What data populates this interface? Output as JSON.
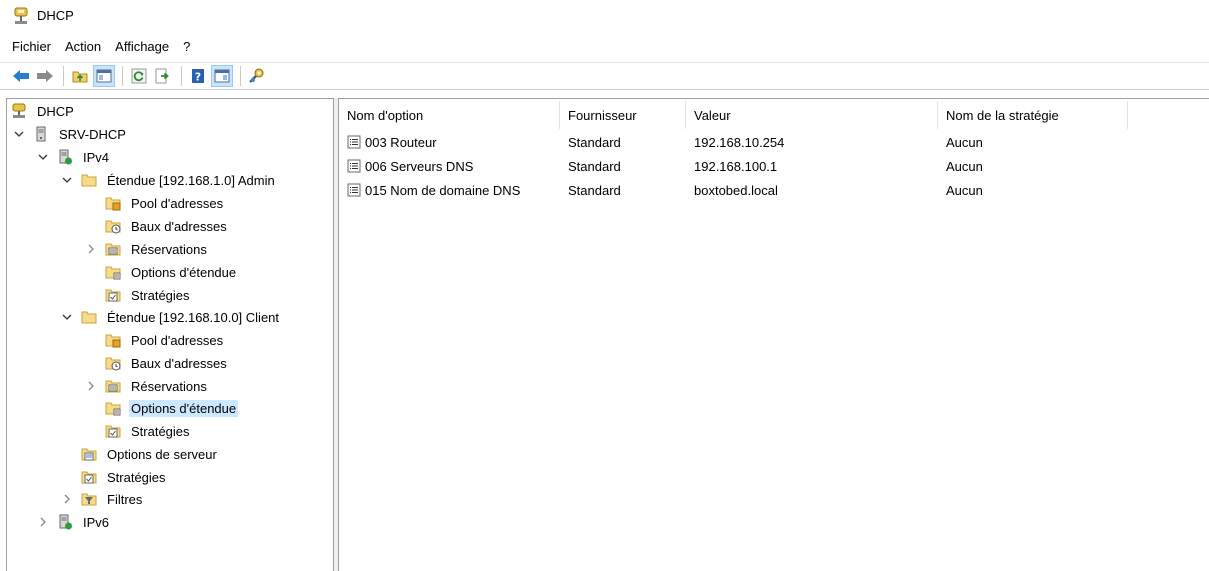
{
  "window": {
    "title": "DHCP"
  },
  "menu": [
    "Fichier",
    "Action",
    "Affichage",
    "?"
  ],
  "toolbar": {
    "buttons": [
      "back-icon",
      "forward-icon",
      "up-folder-icon",
      "show-tree-icon",
      "refresh-icon",
      "export-list-icon",
      "help-icon",
      "action-pane-icon",
      "manage-icon"
    ]
  },
  "tree": {
    "root": "DHCP",
    "server": "SRV-DHCP",
    "ipv4": "IPv4",
    "scope1": {
      "label": "Étendue [192.168.1.0] Admin",
      "pool": "Pool d'adresses",
      "leases": "Baux d'adresses",
      "reservations": "Réservations",
      "options": "Options d'étendue",
      "policies": "Stratégies"
    },
    "scope2": {
      "label": "Étendue [192.168.10.0] Client",
      "pool": "Pool d'adresses",
      "leases": "Baux d'adresses",
      "reservations": "Réservations",
      "options": "Options d'étendue",
      "policies": "Stratégies"
    },
    "server_options": "Options de serveur",
    "policies": "Stratégies",
    "filters": "Filtres",
    "ipv6": "IPv6",
    "selected": "scope2.options"
  },
  "list": {
    "columns": [
      "Nom d'option",
      "Fournisseur",
      "Valeur",
      "Nom de la stratégie"
    ],
    "rows": [
      {
        "name": "003 Routeur",
        "vendor": "Standard",
        "value": "192.168.10.254",
        "policy": "Aucun"
      },
      {
        "name": "006 Serveurs DNS",
        "vendor": "Standard",
        "value": "192.168.100.1",
        "policy": "Aucun"
      },
      {
        "name": "015 Nom de domaine DNS",
        "vendor": "Standard",
        "value": "boxtobed.local",
        "policy": "Aucun"
      }
    ]
  },
  "colors": {
    "selection": "#cce8ff",
    "folder": "#f2cf6e",
    "accent_blue": "#1e72c8"
  }
}
